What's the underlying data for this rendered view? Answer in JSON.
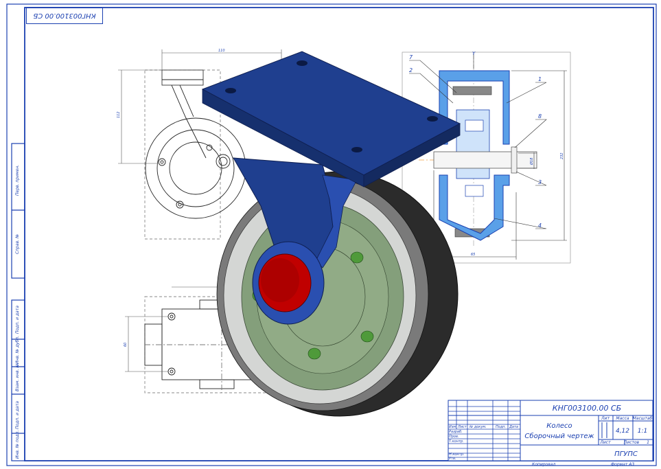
{
  "stamp_code": "КНГ003100.00 СБ",
  "sidebar": {
    "upper": [
      "Перв. примен.",
      "Справ. №"
    ],
    "lower": [
      "Подп. и дата",
      "Инв. № дубл.",
      "Взам. инв. №",
      "Подп. и дата",
      "Инв. № подл."
    ]
  },
  "section_view": {
    "axis_label": "Y",
    "callouts": [
      "7",
      "2",
      "1",
      "8",
      "3",
      "4"
    ],
    "dims": {
      "shaft": "Ø18",
      "height": "232",
      "width": "65"
    }
  },
  "top_view": {
    "dims": {
      "width": "110",
      "height": "112"
    }
  },
  "bottom_view": {
    "dims": {
      "width": "90",
      "height": "60"
    }
  },
  "title_block": {
    "code": "КНГ003100.00 СБ",
    "name_line1": "Колесо",
    "name_line2": "Сборочный чертеж",
    "hdr_lit": "Лит",
    "hdr_mass": "Масса",
    "hdr_scale": "Масштаб",
    "mass": "4,12",
    "scale": "1:1",
    "hdr_sheet": "Лист",
    "hdr_sheets": "Листов",
    "sheets": "1",
    "org": "ПГУПС",
    "rows": [
      "Изм",
      "Лист",
      "№ докум.",
      "Подп.",
      "Дата",
      "Разраб.",
      "Пров.",
      "Т.контр.",
      "Н.контр.",
      "Утв."
    ],
    "copied": "Копировал",
    "format": "Формат  А3"
  },
  "colors": {
    "line": "#1a3fb0",
    "bracket": "#1f3f8f",
    "tire": "#2a2a2a",
    "hub": "#c00000",
    "rim": "#6f8f66"
  }
}
